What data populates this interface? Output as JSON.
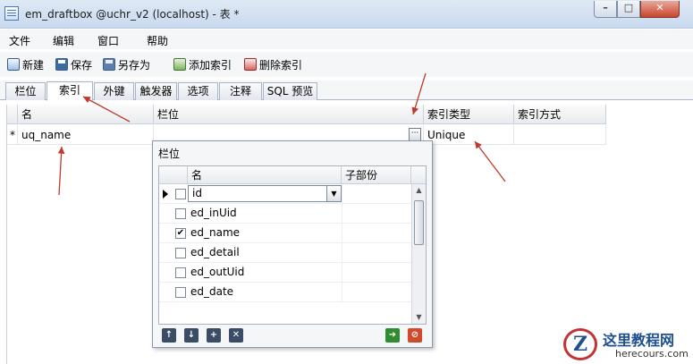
{
  "window": {
    "title": "em_draftbox @uchr_v2 (localhost) - 表 *"
  },
  "menu": [
    "文件",
    "编辑",
    "窗口",
    "帮助"
  ],
  "toolbar": {
    "new": "新建",
    "save": "保存",
    "save_as": "另存为",
    "add_index": "添加索引",
    "delete_index": "删除索引"
  },
  "tabs": [
    "栏位",
    "索引",
    "外键",
    "触发器",
    "选项",
    "注释",
    "SQL 预览"
  ],
  "active_tab": "索引",
  "grid": {
    "columns": [
      "名",
      "栏位",
      "索引类型",
      "索引方式"
    ],
    "rows": [
      {
        "marker": "*",
        "name": "uq_name",
        "fields": "",
        "index_type": "Unique",
        "index_method": ""
      }
    ]
  },
  "popup": {
    "title": "栏位",
    "columns": [
      "名",
      "子部份"
    ],
    "rows": [
      {
        "name": "id",
        "checked": false,
        "current": true
      },
      {
        "name": "ed_inUid",
        "checked": false,
        "current": false
      },
      {
        "name": "ed_name",
        "checked": true,
        "current": false
      },
      {
        "name": "ed_detail",
        "checked": false,
        "current": false
      },
      {
        "name": "ed_outUid",
        "checked": false,
        "current": false
      },
      {
        "name": "ed_date",
        "checked": false,
        "current": false
      }
    ]
  },
  "watermark": {
    "brand": "这里教程网",
    "domain": "herecours.com"
  },
  "colors": {
    "annotation_arrow": "#c0392b",
    "accent": "#1f4f8e"
  },
  "icons": {
    "move_up": "arrow-up-icon",
    "move_down": "arrow-down-icon",
    "add": "plus-icon",
    "remove": "x-icon",
    "ok": "arrow-right-icon",
    "cancel": "cancel-icon"
  }
}
